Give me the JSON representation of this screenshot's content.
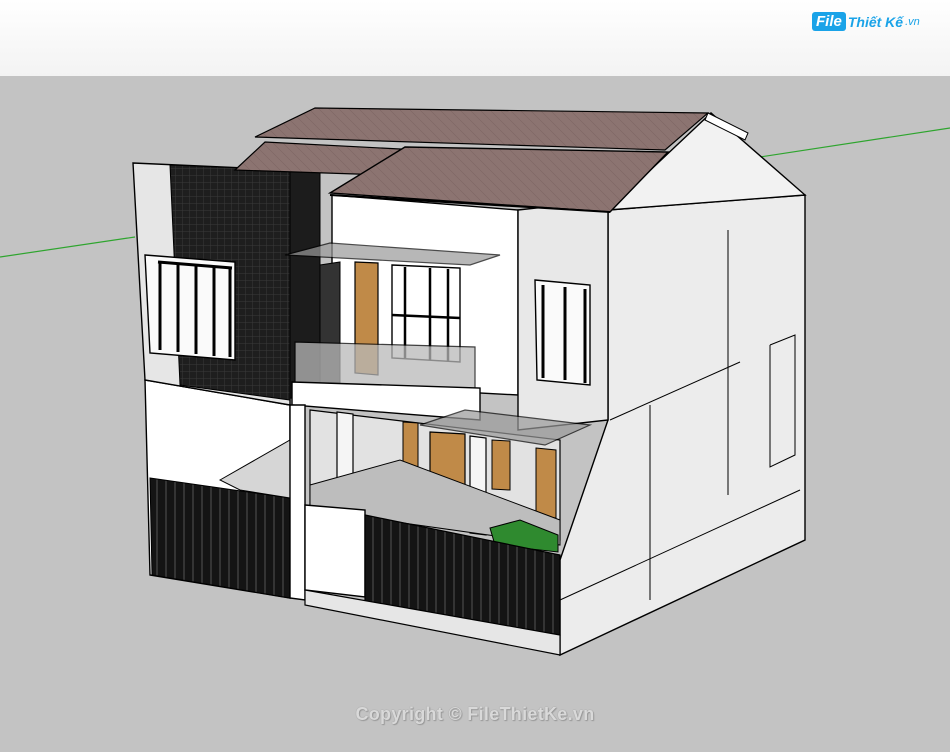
{
  "watermark": {
    "logo_badge": "File",
    "logo_text": "Thiết Kế",
    "logo_suffix": ".vn",
    "copyright": "Copyright © FileThietKe.vn"
  },
  "scene": {
    "subject": "two-storey house 3D model",
    "colors": {
      "sky": "#ffffff",
      "ground": "#c3c3c3",
      "roof": "#8a7370",
      "wall_white": "#ffffff",
      "wall_grey": "#e4e4e4",
      "dark_cladding": "#222222",
      "door_wood": "#c08a48",
      "grass": "#2f8a2f",
      "green_axis": "#2ea52e"
    }
  }
}
